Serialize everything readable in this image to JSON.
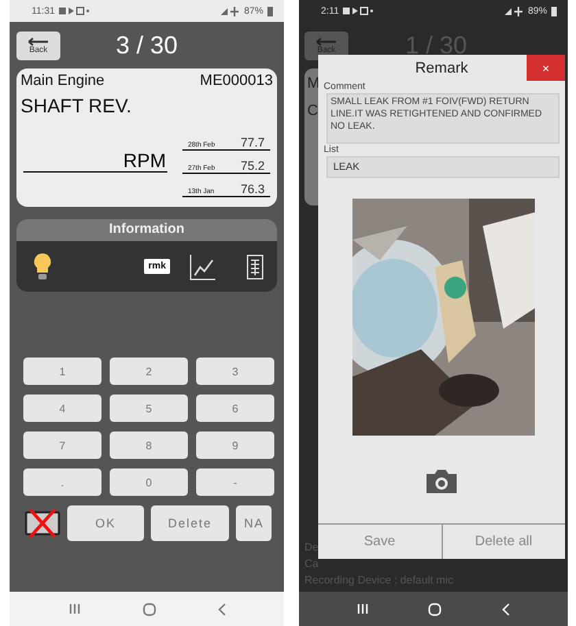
{
  "left": {
    "status": {
      "time": "11:31",
      "battery": "87%"
    },
    "header": {
      "back": "Back",
      "title": "3 / 30"
    },
    "card": {
      "group": "Main Engine",
      "code": "ME000013",
      "name": "SHAFT REV.",
      "unit": "RPM",
      "history": [
        {
          "date": "28th Feb",
          "value": "77.7"
        },
        {
          "date": "27th Feb",
          "value": "75.2"
        },
        {
          "date": "13th Jan",
          "value": "76.3"
        }
      ]
    },
    "info": {
      "title": "Information",
      "tools": [
        {
          "kind": "bulb"
        },
        {
          "kind": "remark",
          "label": "rmk"
        },
        {
          "kind": "chart"
        },
        {
          "kind": "sheet"
        }
      ]
    },
    "keypad": {
      "no_value": {
        "checked": true
      },
      "keys": [
        "1",
        "2",
        "3",
        "4",
        "5",
        "6",
        "7",
        "8",
        "9",
        ".",
        "0",
        "-"
      ],
      "actions": [
        "OK",
        "Delete",
        "NA"
      ]
    }
  },
  "right": {
    "status": {
      "time": "2:11",
      "battery": "89%"
    },
    "behind": {
      "back": "Back",
      "title": "1 / 30",
      "card_letters": [
        "M",
        "C"
      ],
      "lines": [
        "De",
        "Ca",
        "Recording Device : default mic"
      ]
    },
    "dialog": {
      "title": "Remark",
      "close": "×",
      "comment_label": "Comment",
      "comment": "SMALL LEAK FROM #1 FOIV(FWD)  RETURN LINE.IT WAS RETIGHTENED AND CONFIRMED NO LEAK.",
      "list_label": "List",
      "list_value": "LEAK",
      "buttons": [
        "Save",
        "Delete all"
      ]
    }
  }
}
